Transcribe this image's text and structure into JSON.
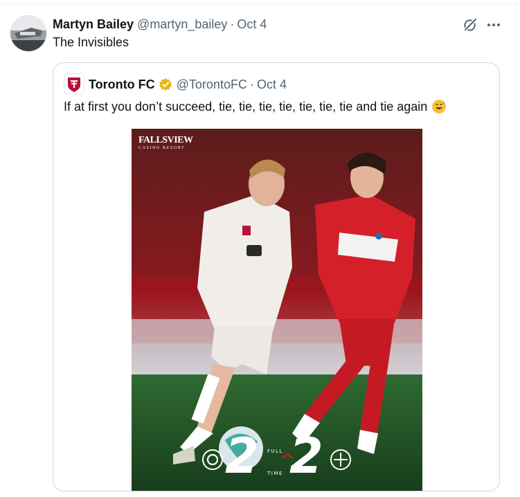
{
  "post": {
    "author_name": "Martyn Bailey",
    "author_handle": "@martyn_bailey",
    "separator": "·",
    "date": "Oct 4",
    "text": "The Invisibles",
    "avatar_icon": "user-avatar",
    "grok_icon": "grok-icon",
    "more_icon": "more-icon"
  },
  "quoted": {
    "author_name": "Toronto FC",
    "author_handle": "@TorontoFC",
    "separator": "·",
    "date": "Oct 4",
    "text": "If at first you don’t succeed, tie, tie, tie, tie, tie, tie, tie and tie again",
    "verified_badge": "verified-gold-icon",
    "emoji": "grinning-sweat-emoji",
    "media": {
      "sponsor_name": "FALLSVIEW",
      "sponsor_sub": "CASINO RESORT",
      "home_score": "2",
      "away_score": "2",
      "status_top": "FULL",
      "status_bottom": "TIME"
    }
  },
  "colors": {
    "text_primary": "#0f1419",
    "text_secondary": "#536471",
    "border": "#cfd9de",
    "tfc_red": "#b81137",
    "verified_gold": "#e2b719"
  }
}
